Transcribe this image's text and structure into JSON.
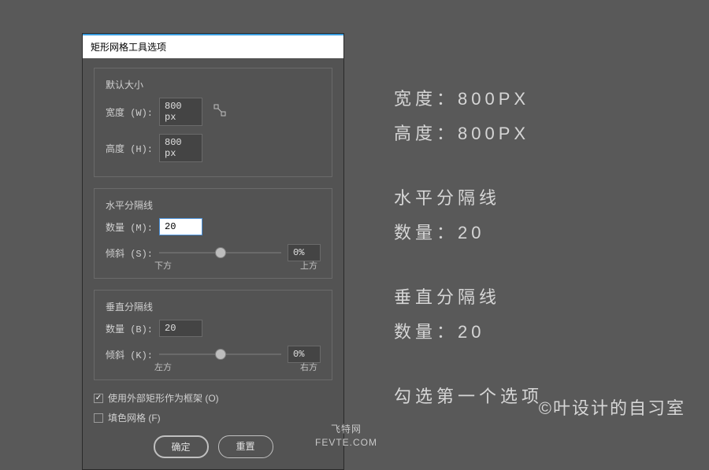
{
  "dialog": {
    "title": "矩形网格工具选项",
    "default_size": {
      "legend": "默认大小",
      "width_label": "宽度 (W):",
      "width_value": "800 px",
      "height_label": "高度 (H):",
      "height_value": "800 px"
    },
    "horizontal": {
      "legend": "水平分隔线",
      "count_label": "数量 (M):",
      "count_value": "20",
      "skew_label": "倾斜 (S):",
      "skew_value": "0%",
      "label_low": "下方",
      "label_high": "上方"
    },
    "vertical": {
      "legend": "垂直分隔线",
      "count_label": "数量 (B):",
      "count_value": "20",
      "skew_label": "倾斜 (K):",
      "skew_value": "0%",
      "label_low": "左方",
      "label_high": "右方"
    },
    "checkbox1": {
      "checked": "✓",
      "label": "使用外部矩形作为框架 (O)"
    },
    "checkbox2": {
      "checked": "",
      "label": "填色网格 (F)"
    },
    "ok_button": "确定",
    "reset_button": "重置"
  },
  "annotations": {
    "line1": "宽度：800PX",
    "line2": "高度：800PX",
    "line3": "水平分隔线",
    "line4": "数量：20",
    "line5": "垂直分隔线",
    "line6": "数量：20",
    "line7": "勾选第一个选项"
  },
  "credit": "©叶设计的自习室",
  "watermark_top": "飞特网",
  "watermark_bottom": "FEVTE.COM"
}
